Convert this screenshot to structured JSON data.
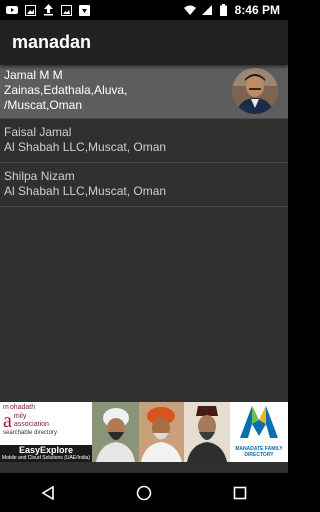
{
  "status_bar": {
    "time": "8:46 PM",
    "left_icons": [
      "youtube-icon",
      "image-icon",
      "upload-icon",
      "gallery-icon",
      "download-icon"
    ],
    "right_icons": [
      "wifi-icon",
      "signal-icon",
      "battery-icon"
    ]
  },
  "app_bar": {
    "title": "manadan"
  },
  "contacts": [
    {
      "name": "Jamal M M",
      "address_line1": "Zainas,Edathala,Aluva,",
      "address_line2": "/Muscat,Oman",
      "has_photo": true,
      "selected": true
    },
    {
      "name": "Faisal Jamal",
      "address_line1": "Al Shabah LLC,Muscat, Oman",
      "has_photo": false,
      "selected": false
    },
    {
      "name": "Shilpa Nizam",
      "address_line1": "Al Shabah LLC,Muscat, Oman",
      "has_photo": false,
      "selected": false
    }
  ],
  "banner": {
    "brand_prefix": "m",
    "brand_line1": "ohadath",
    "brand_line1b": "mily",
    "brand_line1c": "association",
    "brand_sub": "searchable directory",
    "easyexplore_name": "EasyExplore",
    "easyexplore_sub": "Mobile and Cloud Solutions (UAE/India)",
    "right_logo_text1": "MANADATE FAMILY",
    "right_logo_text2": "DIRECTORY"
  },
  "nav": {
    "icons": [
      "back-icon",
      "home-icon",
      "recents-icon"
    ]
  },
  "colors": {
    "app_bar": "#212121",
    "background": "#303030",
    "selected_row": "#5d5d5d",
    "brand_red": "#a3162d",
    "logo_blue": "#0a6fb0"
  }
}
